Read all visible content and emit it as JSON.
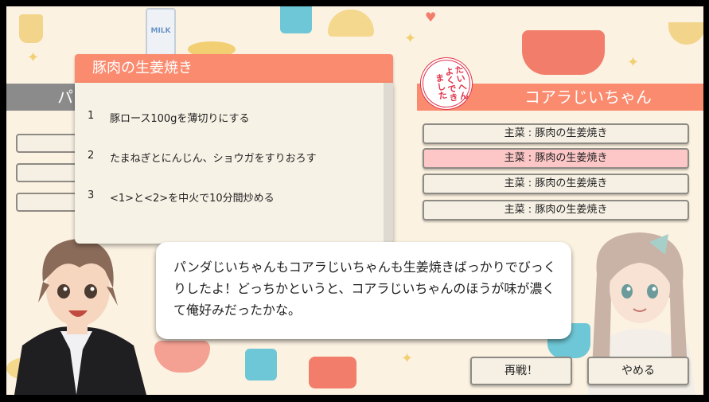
{
  "recipe": {
    "title": "豚肉の生姜焼き",
    "steps": [
      {
        "num": "1",
        "text": "豚ロース100gを薄切りにする"
      },
      {
        "num": "2",
        "text": "たまねぎとにんじん、ショウガをすりおろす"
      },
      {
        "num": "3",
        "text": "<1>と<2>を中火で10分間炒める"
      }
    ]
  },
  "left_panel": {
    "header_visible": "パ"
  },
  "stamp": {
    "text": "たいへんよくできました"
  },
  "right_panel": {
    "name": "コアラじいちゃん",
    "dishes": [
      {
        "label": "主菜 : 豚肉の生姜焼き",
        "selected": false
      },
      {
        "label": "主菜 : 豚肉の生姜焼き",
        "selected": true
      },
      {
        "label": "主菜 : 豚肉の生姜焼き",
        "selected": false
      },
      {
        "label": "主菜 : 豚肉の生姜焼き",
        "selected": false
      }
    ]
  },
  "dialogue": {
    "text": "パンダじいちゃんもコアラじいちゃんも生姜焼きばっかりでびっくりしたよ！どっちかというと、コアラじいちゃんのほうが味が濃くて俺好みだったかな。"
  },
  "buttons": {
    "rematch": "再戦！",
    "quit": "やめる"
  },
  "background": {
    "milk_label": "MILK"
  },
  "colors": {
    "accent": "#fa8b6f",
    "selected": "#fdc7c7",
    "card_bg": "#f7f2e6",
    "stage_bg": "#fcf2e2"
  }
}
